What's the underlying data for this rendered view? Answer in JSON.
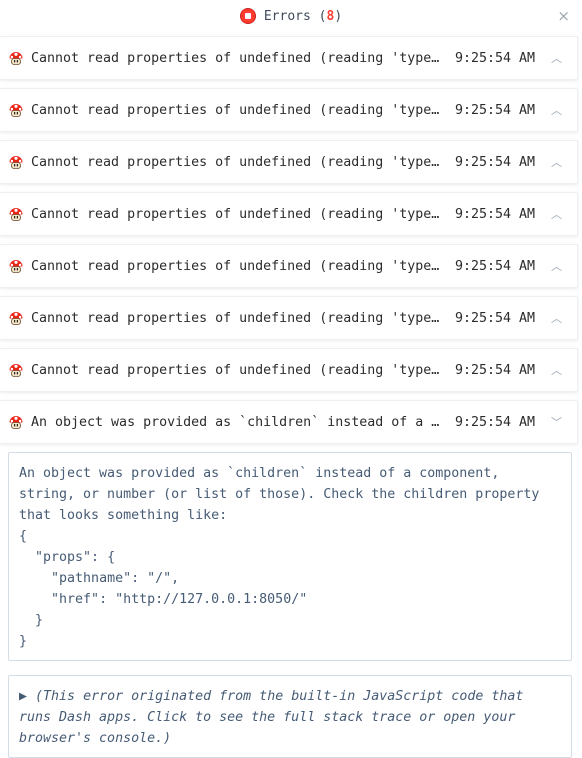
{
  "header": {
    "title": "Errors",
    "count_open": "(",
    "count": "8",
    "count_close": ")",
    "close_glyph": "×"
  },
  "errors": [
    {
      "message": "Cannot read properties of undefined (reading 'type')",
      "time": "9:25:54 AM",
      "chevron": "^"
    },
    {
      "message": "Cannot read properties of undefined (reading 'type')",
      "time": "9:25:54 AM",
      "chevron": "^"
    },
    {
      "message": "Cannot read properties of undefined (reading 'type')",
      "time": "9:25:54 AM",
      "chevron": "^"
    },
    {
      "message": "Cannot read properties of undefined (reading 'type')",
      "time": "9:25:54 AM",
      "chevron": "^"
    },
    {
      "message": "Cannot read properties of undefined (reading 'type')",
      "time": "9:25:54 AM",
      "chevron": "^"
    },
    {
      "message": "Cannot read properties of undefined (reading 'type')",
      "time": "9:25:54 AM",
      "chevron": "^"
    },
    {
      "message": "Cannot read properties of undefined (reading 'type')",
      "time": "9:25:54 AM",
      "chevron": "^"
    },
    {
      "message": "An object was provided as `children` instead of a c…",
      "time": "9:25:54 AM",
      "chevron": "v"
    }
  ],
  "detail": {
    "text": "An object was provided as `children` instead of a component, string, or number (or list of those). Check the children property that looks something like:\n{\n  \"props\": {\n    \"pathname\": \"/\",\n    \"href\": \"http://127.0.0.1:8050/\"\n  }\n}"
  },
  "trace": {
    "arrow": "▶",
    "text": "(This error originated from the built-in JavaScript code that runs Dash apps. Click to see the full stack trace or open your browser's console.)"
  },
  "colors": {
    "accent_red": "#ff4136",
    "text_blue": "#465b75"
  },
  "icons": {
    "row_icon": "mushroom-error-icon",
    "header_icon": "stop-icon"
  }
}
